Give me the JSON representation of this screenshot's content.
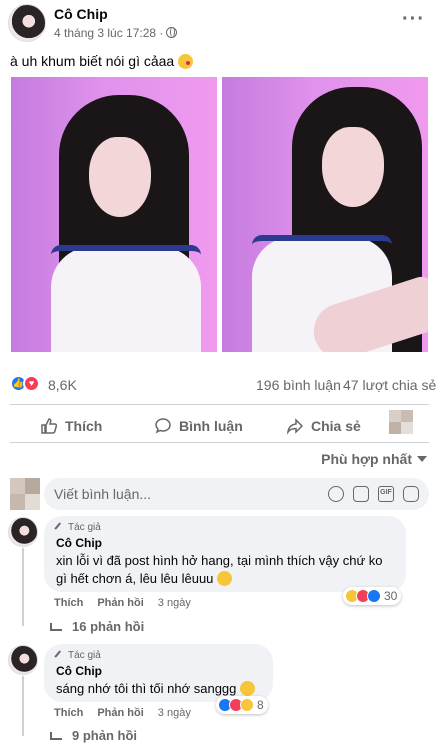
{
  "post": {
    "author": "Cô Chip",
    "time": "4 tháng 3 lúc 17:28 ·",
    "more": "···",
    "text": "à uh khum biết nói gì cảaa"
  },
  "stats": {
    "reactions": "8,6K",
    "comments": "196 bình luận",
    "shares": "47 lượt chia sẻ"
  },
  "actions": {
    "like": "Thích",
    "comment": "Bình luận",
    "share": "Chia sẻ"
  },
  "sort_label": "Phù hợp nhất",
  "comment_input": {
    "placeholder": "Viết bình luận..."
  },
  "comments": [
    {
      "badge": "Tác giả",
      "name": "Cô Chip",
      "text": "xin lỗi vì đã post hình hở hang, tại mình thích vậy chứ ko gì hết chơn á, lêu lêu lêuuu",
      "like": "Thích",
      "reply": "Phản hồi",
      "ago": "3 ngày",
      "reactions": "30",
      "replies": "16 phản hồi"
    },
    {
      "badge": "Tác giả",
      "name": "Cô Chip",
      "text": "sáng nhớ tôi thì tối nhớ sanggg",
      "like": "Thích",
      "reply": "Phản hồi",
      "ago": "3 ngày",
      "reactions": "8",
      "replies": "9 phản hồi"
    }
  ],
  "colors": {
    "accent": "#1877f2",
    "love": "#f33e58",
    "muted": "#65676b",
    "bubble": "#f0f2f5"
  }
}
